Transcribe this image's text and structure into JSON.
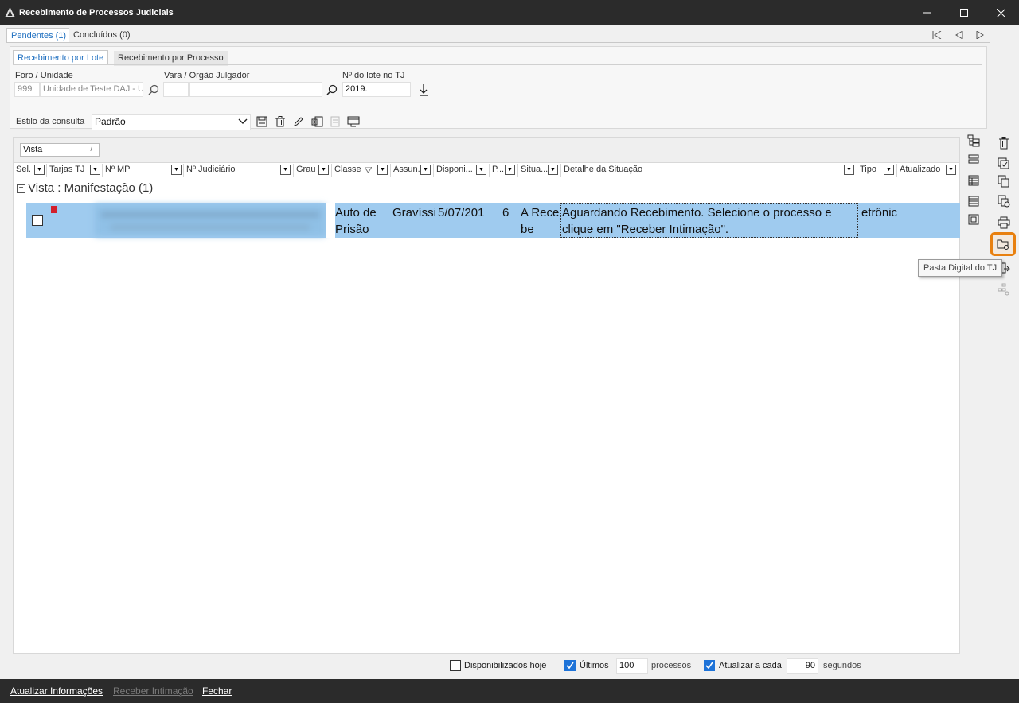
{
  "window": {
    "title": "Recebimento de Processos Judiciais",
    "minimize": "—",
    "maximize": "☐",
    "close": "✕"
  },
  "tabs": {
    "pendentes": "Pendentes (1)",
    "concluidos": "Concluídos (0)"
  },
  "subtabs": {
    "lote": "Recebimento por Lote",
    "processo": "Recebimento por Processo"
  },
  "filters": {
    "foro_label": "Foro / Unidade",
    "foro_code": "999",
    "foro_name": "Unidade de Teste DAJ - U",
    "vara_label": "Vara / Orgão Julgador",
    "vara_code": "",
    "vara_name": "",
    "lote_label": "Nº do lote no TJ",
    "lote_value": "2019."
  },
  "consulta": {
    "label": "Estilo da consulta",
    "selected": "Padrão"
  },
  "group_panel": {
    "vista_chip": "Vista",
    "sort_glyph": "/"
  },
  "columns": [
    "Sel.",
    "Tarjas TJ",
    "Nº MP",
    "Nº Judiciário",
    "Grau",
    "Classe",
    "Assun...",
    "Disponi...",
    "P...",
    "Situa...",
    "Detalhe da Situação",
    "Tipo",
    "Atualizado"
  ],
  "group": {
    "toggle": "−",
    "label": "Vista : Manifestação (1)"
  },
  "row": {
    "classe": "Auto de Prisão",
    "assunto": "Gravíssi",
    "disponibilizado": "5/07/201",
    "p": "6",
    "situacao": "A Recebe",
    "detalhe": "Aguardando Recebimento. Selecione o processo e clique em \"Receber Intimação\".",
    "tipo": "etrônic"
  },
  "tooltip": "Pasta Digital do TJ",
  "footer": {
    "disp_hoje": "Disponibilizados hoje",
    "disp_hoje_checked": false,
    "ultimos": "Últimos",
    "ultimos_checked": true,
    "ultimos_value": "100",
    "processos": "processos",
    "atualizar": "Atualizar a cada",
    "atualizar_checked": true,
    "atualizar_value": "90",
    "segundos": "segundos"
  },
  "actions": {
    "atualizar": "Atualizar Informações",
    "receber": "Receber Intimação",
    "fechar": "Fechar"
  },
  "colors": {
    "selected_row": "#9fcbef",
    "highlight": "#e8800f",
    "tarja": "#d21f2b",
    "accent": "#1e73d8"
  }
}
